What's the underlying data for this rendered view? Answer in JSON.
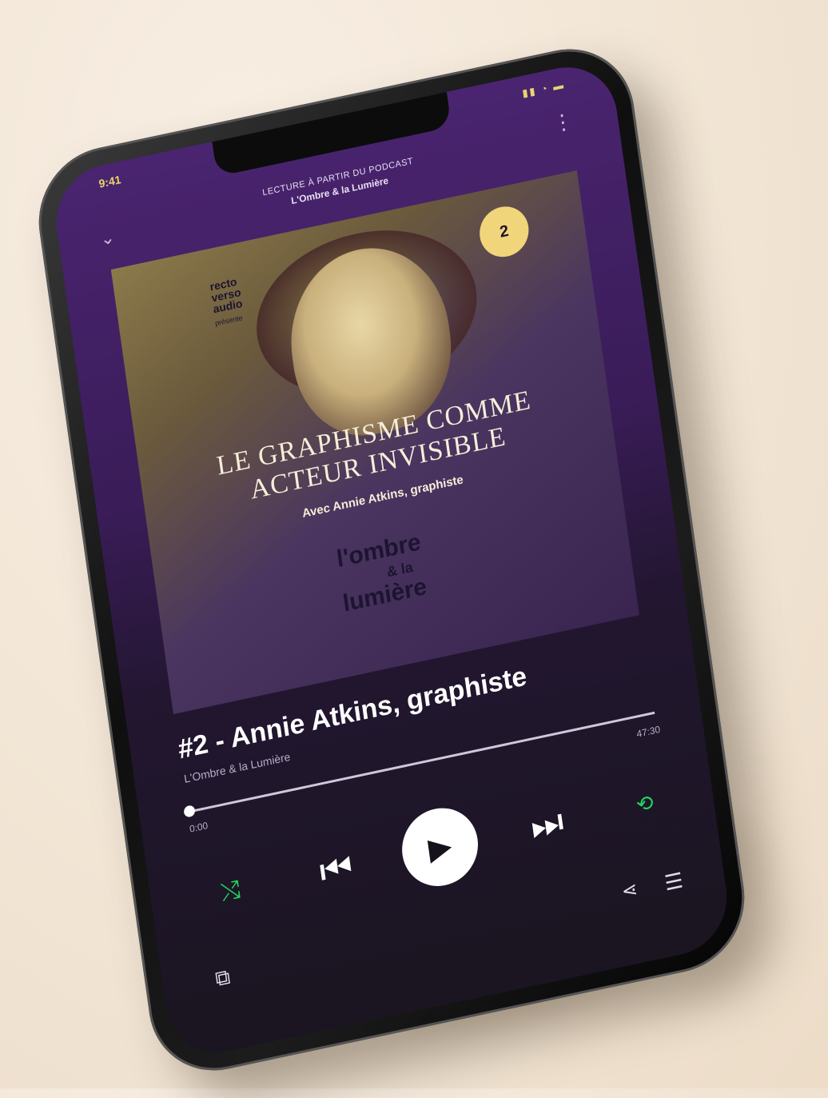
{
  "status": {
    "time": "9:41",
    "icons": "▮▮ ◔ ▬"
  },
  "header": {
    "context_label": "LECTURE À PARTIR DU PODCAST",
    "context_name": "L'Ombre & la Lumière",
    "collapse_icon": "chevron-down-icon",
    "more_icon": "more-icon"
  },
  "artwork": {
    "brand": [
      "recto",
      "verso",
      "audio"
    ],
    "brand_sub": "présente",
    "badge": "2",
    "title_line1": "LE GRAPHISME COMME",
    "title_line2": "ACTEUR INVISIBLE",
    "subtitle": "Avec Annie Atkins, graphiste",
    "logo_line1": "l'ombre",
    "logo_amp": "& la",
    "logo_line2": "lumière"
  },
  "track": {
    "title": "#2 - Annie Atkins, graphiste",
    "artist": "L'Ombre & la Lumière"
  },
  "playback": {
    "progress": 0,
    "elapsed": "0:00",
    "duration": "47:30"
  },
  "icons": {
    "shuffle": "⤭",
    "prev": "⏮",
    "play": "▶",
    "next": "⏭",
    "repeat": "⟲",
    "devices": "⧉",
    "share": "⋖",
    "queue": "☰"
  },
  "colors": {
    "accent_green": "#1ed760",
    "status_yellow": "#e9d56a",
    "header_purple": "#4a2470"
  }
}
